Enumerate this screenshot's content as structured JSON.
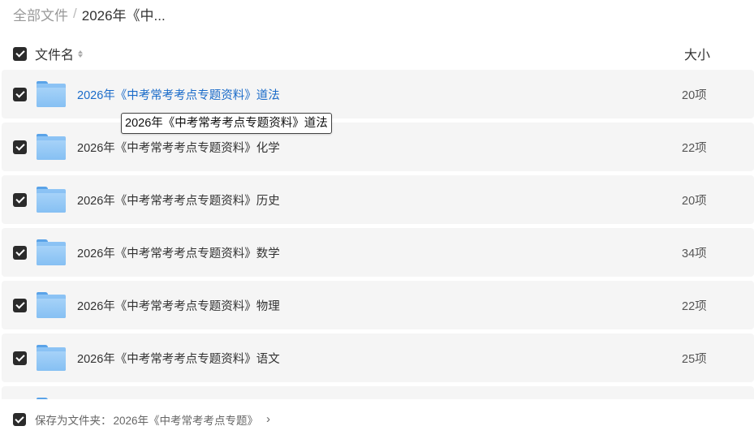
{
  "breadcrumb": {
    "root": "全部文件",
    "separator": "/",
    "current": "2026年《中..."
  },
  "columns": {
    "name": "文件名",
    "size": "大小"
  },
  "files": [
    {
      "name": "2026年《中考常考考点专题资料》道法",
      "size": "20项"
    },
    {
      "name": "2026年《中考常考考点专题资料》化学",
      "size": "22项"
    },
    {
      "name": "2026年《中考常考考点专题资料》历史",
      "size": "20项"
    },
    {
      "name": "2026年《中考常考考点专题资料》数学",
      "size": "34项"
    },
    {
      "name": "2026年《中考常考考点专题资料》物理",
      "size": "22项"
    },
    {
      "name": "2026年《中考常考考点专题资料》语文",
      "size": "25项"
    }
  ],
  "tooltip": "2026年《中考常考考点专题资料》道法",
  "footer": {
    "label": "保存为文件夹：",
    "path": "2026年《中考常考考点专题》",
    "chevron": "›"
  },
  "icons": {
    "folder": "folder-icon",
    "checkbox": "checkbox-checked-icon",
    "sort": "sort-icon",
    "chevron": "chevron-right-icon"
  },
  "colors": {
    "link_hover": "#1a6bc9",
    "checkbox": "#2b2b2b",
    "row_bg": "#f5f5f5",
    "folder": "#8ec4f5"
  }
}
